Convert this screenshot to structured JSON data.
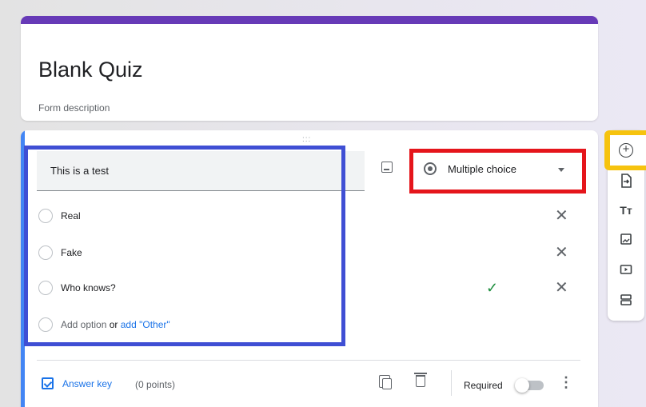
{
  "form": {
    "title": "Blank Quiz",
    "description_placeholder": "Form description",
    "accent_color": "#673ab7"
  },
  "question": {
    "drag_handle": ":::",
    "title": "This is a test",
    "type_selected": "Multiple choice",
    "options": [
      {
        "label": "Real"
      },
      {
        "label": "Fake"
      },
      {
        "label": "Who knows?",
        "correct": true
      }
    ],
    "add_option": "Add option",
    "or_text": "or",
    "add_other": "add \"Other\"",
    "answer_key": "Answer key",
    "points": "(0 points)",
    "required_label": "Required",
    "required": false
  },
  "toolbar": {
    "icons": [
      "add-question-icon",
      "import-questions-icon",
      "add-title-icon",
      "add-image-icon",
      "add-video-icon",
      "add-section-icon"
    ]
  },
  "colors": {
    "highlight_blue": "#3f4fd4",
    "highlight_red": "#e5151b",
    "highlight_yellow": "#f6c30e",
    "link_blue": "#1a73e8",
    "correct_green": "#1e8e3e"
  }
}
